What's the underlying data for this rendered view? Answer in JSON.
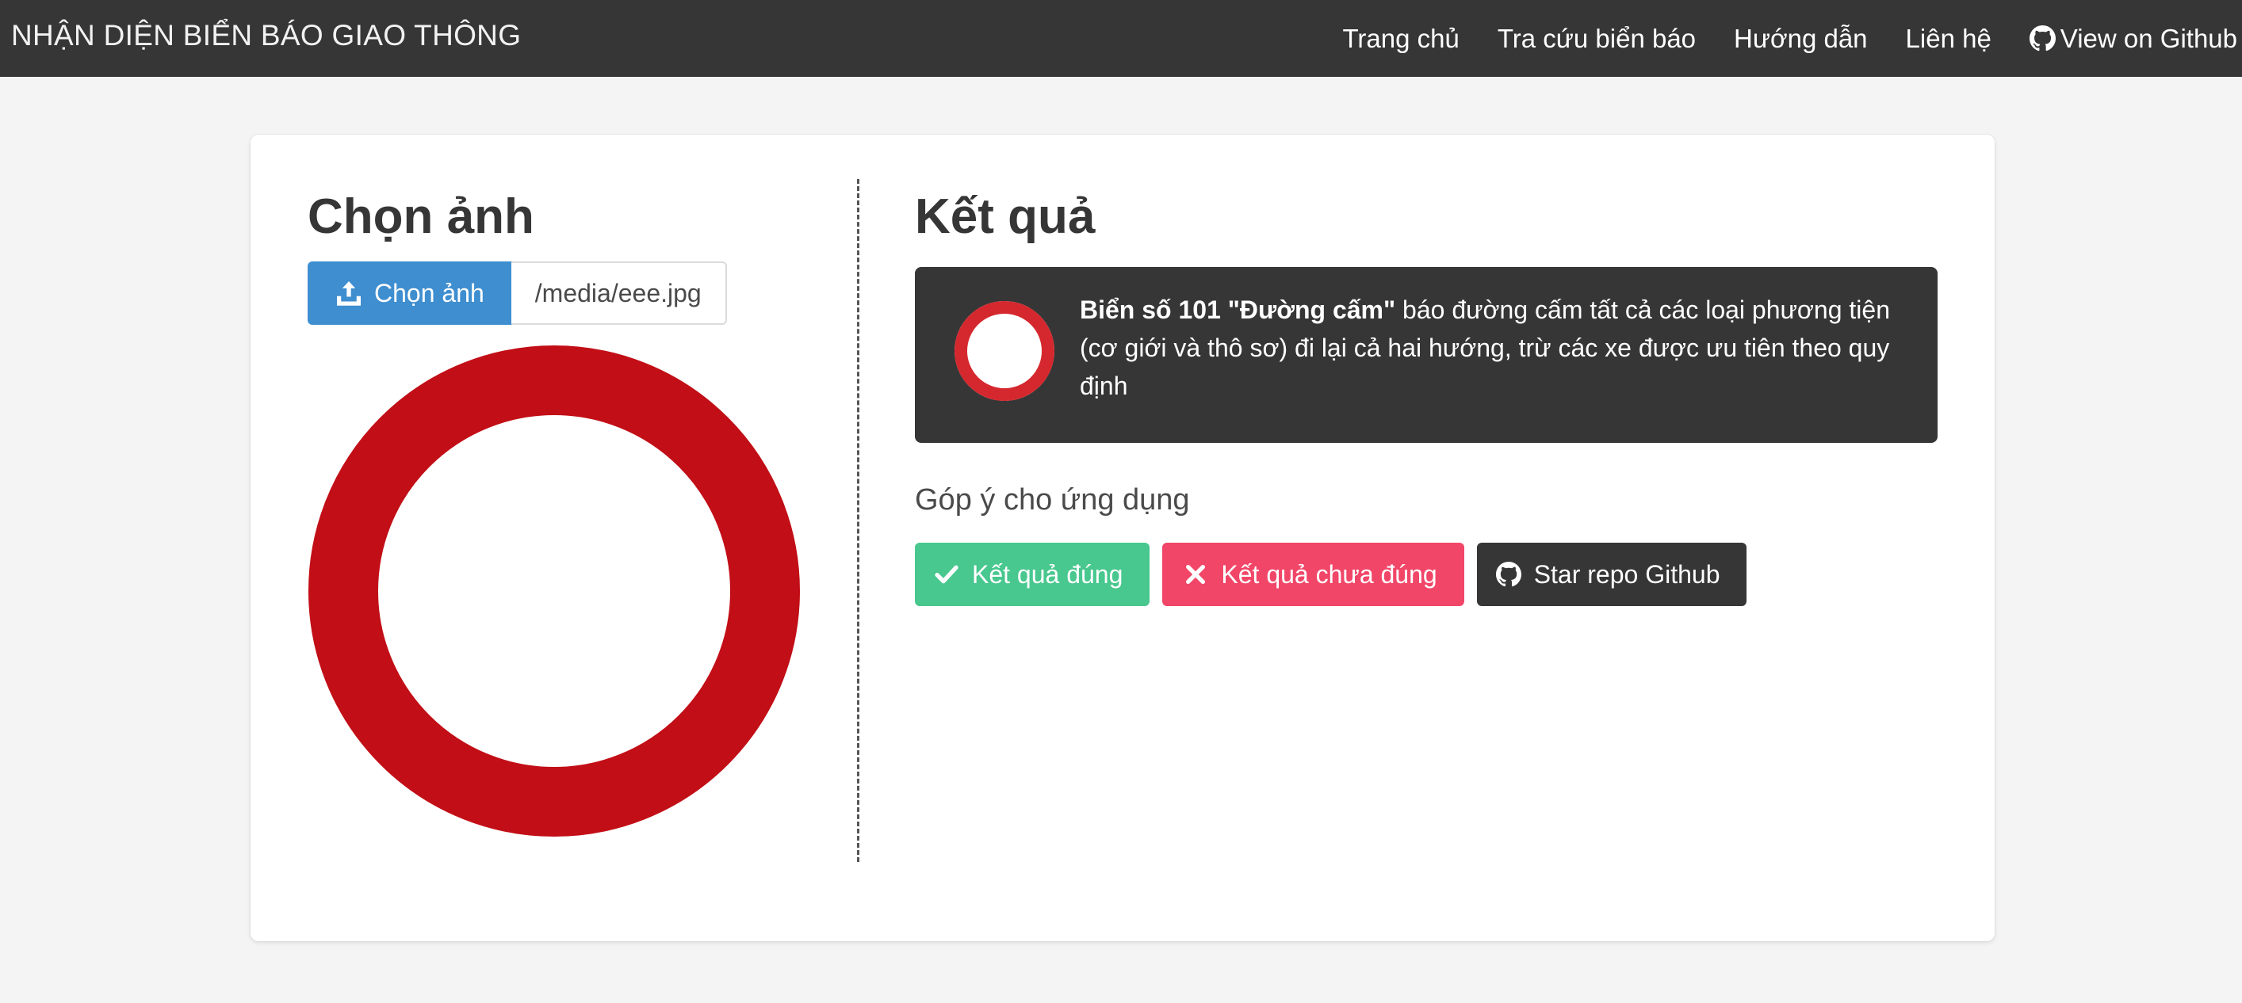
{
  "navbar": {
    "brand": "NHẬN DIỆN BIỂN BÁO GIAO THÔNG",
    "items": [
      {
        "label": "Trang chủ"
      },
      {
        "label": "Tra cứu biển báo"
      },
      {
        "label": "Hướng dẫn"
      },
      {
        "label": "Liên hệ"
      },
      {
        "label": "View on Github",
        "icon": "github-icon"
      }
    ]
  },
  "upload": {
    "title": "Chọn ảnh",
    "button_label": "Chọn ảnh",
    "button_icon": "upload-icon",
    "file_name": "/media/eee.jpg",
    "preview_icon": "no-entry-sign-red-ring"
  },
  "result": {
    "title": "Kết quả",
    "sign_name": "Biển số 101 \"Đường cấm\"",
    "description": " báo đường cấm tất cả các loại phương tiện (cơ giới và thô sơ) đi lại cả hai hướng, trừ các xe được ưu tiên theo quy định"
  },
  "feedback": {
    "title": "Góp ý cho ứng dụng",
    "correct_label": "Kết quả đúng",
    "incorrect_label": "Kết quả chưa đúng",
    "star_label": "Star repo Github"
  },
  "colors": {
    "navbar": "#363636",
    "primary": "#3e8ed0",
    "success": "#48c78e",
    "danger": "#f14668",
    "dark": "#363636",
    "sign_red": "#c20e16"
  }
}
